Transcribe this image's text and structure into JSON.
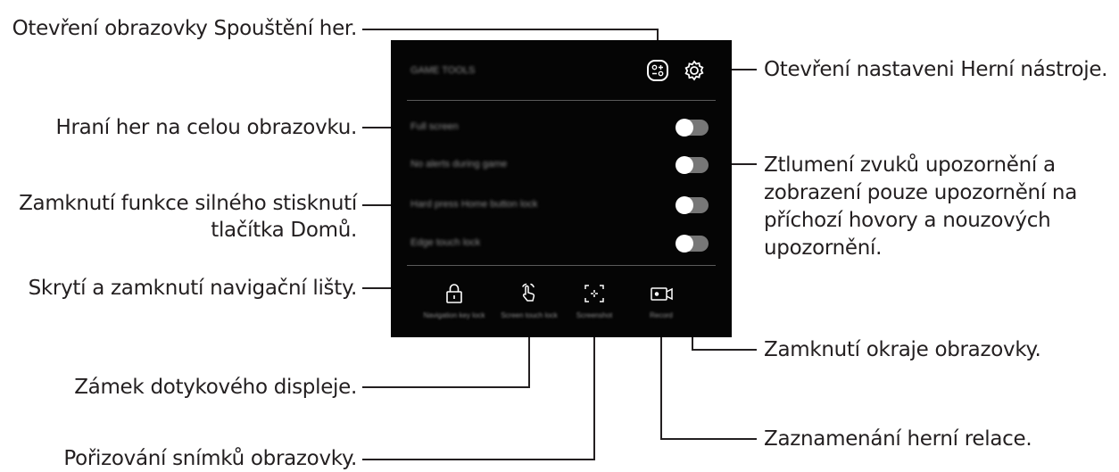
{
  "screen": {
    "title": "GAME TOOLS",
    "options": [
      {
        "label": "Full screen",
        "on": false
      },
      {
        "label": "No alerts during game",
        "on": false
      },
      {
        "label": "Hard press Home button lock",
        "on": false
      },
      {
        "label": "Edge touch lock",
        "on": false
      }
    ],
    "tools": [
      {
        "label": "Navigation key lock",
        "icon": "lock-icon"
      },
      {
        "label": "Screen touch lock",
        "icon": "touch-hand-icon"
      },
      {
        "label": "Screenshot",
        "icon": "screenshot-icon"
      },
      {
        "label": "Record",
        "icon": "record-icon"
      }
    ]
  },
  "callouts": {
    "game_launcher": "Otevření obrazovky Spouštění her.",
    "settings": "Otevření nastaveni Herní nástroje.",
    "full_screen": "Hraní her na celou obrazovku.",
    "no_alerts": [
      "Ztlumení zvuků upozornění a",
      "zobrazení pouze upozornění na",
      "příchozí hovory a nouzových",
      "upozornění."
    ],
    "home_lock": [
      "Zamknutí funkce silného stisknutí",
      "tlačítka Domů."
    ],
    "nav_lock": "Skrytí a zamknutí navigační lišty.",
    "edge_lock": "Zamknutí okraje obrazovky.",
    "touch_lock": "Zámek dotykového displeje.",
    "screenshot": "Pořizování snímků obrazovky.",
    "record": "Zaznamenání herní relace."
  }
}
